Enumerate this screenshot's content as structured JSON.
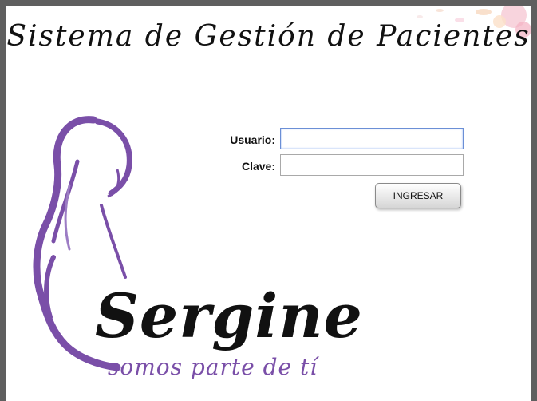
{
  "header": {
    "title": "Sistema de Gestión de Pacientes"
  },
  "login": {
    "usuario_label": "Usuario:",
    "usuario_value": "",
    "clave_label": "Clave:",
    "clave_value": "",
    "submit_label": "INGRESAR"
  },
  "brand": {
    "name": "Sergine",
    "tagline": "somos parte de tí"
  },
  "colors": {
    "accent": "#7a4fa8",
    "frame": "#5f5f5f"
  }
}
